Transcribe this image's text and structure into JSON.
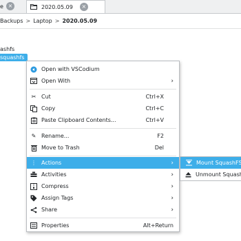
{
  "tabs": [
    {
      "label": "e"
    },
    {
      "label": "2020.05.09"
    }
  ],
  "breadcrumb": {
    "items": [
      "Backups",
      "Laptop"
    ],
    "current": "2020.05.09",
    "separator": ">"
  },
  "files": [
    {
      "name": "ashfs"
    },
    {
      "name": "squashfs"
    }
  ],
  "context_menu": {
    "open_with_vscodium": "Open with VSCodium",
    "open_with": "Open With",
    "cut": "Cut",
    "cut_shortcut": "Ctrl+X",
    "copy": "Copy",
    "copy_shortcut": "Ctrl+C",
    "paste": "Paste Clipboard Contents...",
    "paste_shortcut": "Ctrl+V",
    "rename": "Rename...",
    "rename_shortcut": "F2",
    "trash": "Move to Trash",
    "trash_shortcut": "Del",
    "actions": "Actions",
    "activities": "Activities",
    "compress": "Compress",
    "assign_tags": "Assign Tags",
    "share": "Share",
    "properties": "Properties",
    "properties_shortcut": "Alt+Return"
  },
  "submenu": {
    "mount": "Mount SquashFS",
    "unmount": "Unmount SquashFS"
  },
  "colors": {
    "accent": "#3daee9",
    "text": "#232629"
  }
}
